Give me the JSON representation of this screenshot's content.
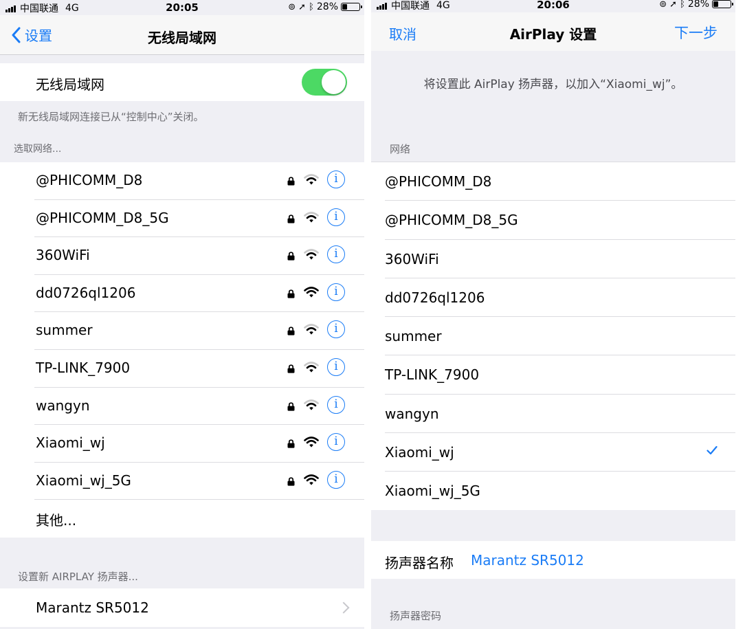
{
  "left": {
    "status": {
      "carrier": "中国联通",
      "network": "4G",
      "time": "20:05",
      "battery": "28%"
    },
    "nav": {
      "back_label": "设置",
      "title": "无线局域网"
    },
    "wifi_toggle": {
      "label": "无线局域网",
      "on": true
    },
    "notice": "新无线局域网连接已从“控制中心”关闭。",
    "choose_header": "选取网络...",
    "networks": [
      {
        "name": "@PHICOMM_D8",
        "strength": 2
      },
      {
        "name": "@PHICOMM_D8_5G",
        "strength": 2
      },
      {
        "name": "360WiFi",
        "strength": 2
      },
      {
        "name": "dd0726ql1206",
        "strength": 3
      },
      {
        "name": "summer",
        "strength": 2
      },
      {
        "name": "TP-LINK_7900",
        "strength": 2
      },
      {
        "name": "wangyn",
        "strength": 2
      },
      {
        "name": "Xiaomi_wj",
        "strength": 3
      },
      {
        "name": "Xiaomi_wj_5G",
        "strength": 3
      }
    ],
    "info_glyph": "i",
    "other_label": "其他...",
    "airplay_header": "设置新 AIRPLAY 扬声器...",
    "airplay_device": "Marantz SR5012"
  },
  "right": {
    "status": {
      "carrier": "中国联通",
      "network": "4G",
      "time": "20:06",
      "battery": "28%"
    },
    "nav": {
      "cancel_label": "取消",
      "title": "AirPlay 设置",
      "next_label": "下一步"
    },
    "description": "将设置此 AirPlay 扬声器，以加入“Xiaomi_wj”。",
    "network_header": "网络",
    "networks": [
      "@PHICOMM_D8",
      "@PHICOMM_D8_5G",
      "360WiFi",
      "dd0726ql1206",
      "summer",
      "TP-LINK_7900",
      "wangyn",
      "Xiaomi_wj",
      "Xiaomi_wj_5G"
    ],
    "selected_network": "Xiaomi_wj",
    "speaker_name_label": "扬声器名称",
    "speaker_name_value": "Marantz SR5012",
    "speaker_password_header": "扬声器密码"
  },
  "colors": {
    "accent": "#1a7cf6",
    "toggle_on": "#4cd964",
    "group_bg": "#efeff4",
    "secondary_text": "#6d6d72"
  }
}
